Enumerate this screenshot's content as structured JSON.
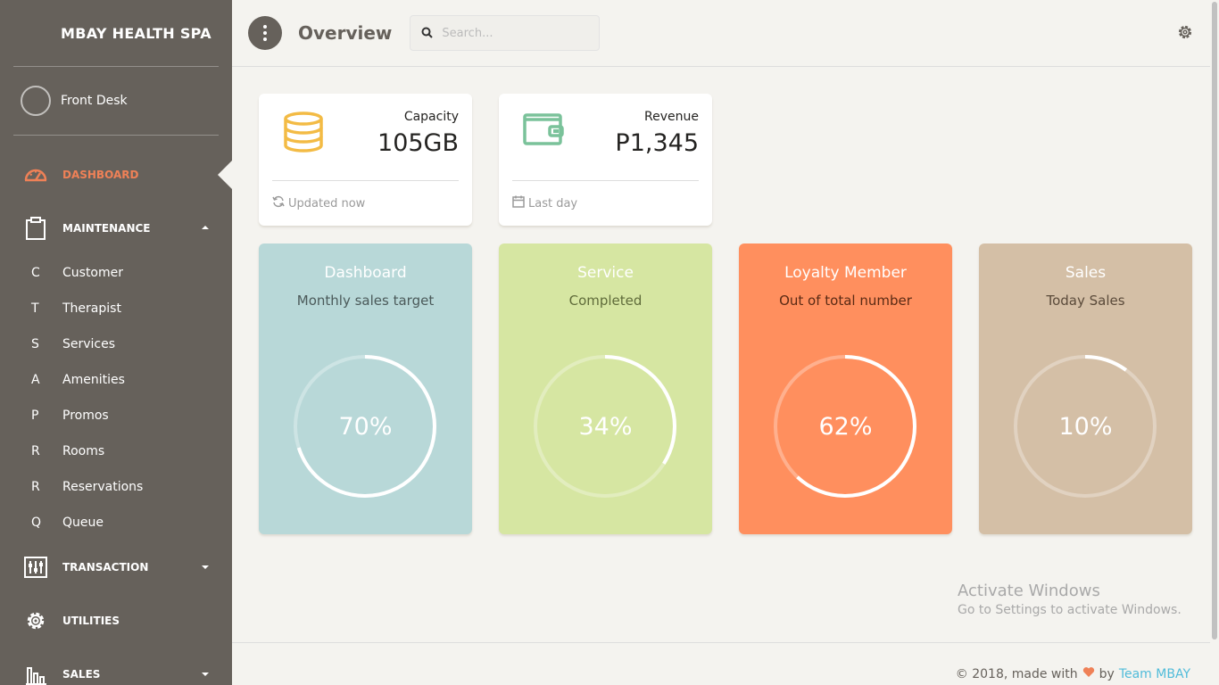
{
  "sidebar": {
    "brand": "MBAY HEALTH SPA",
    "user": "Front Desk",
    "nav": {
      "dashboard": "DASHBOARD",
      "maintenance": "MAINTENANCE",
      "transaction": "TRANSACTION",
      "utilities": "UTILITIES",
      "sales": "SALES"
    },
    "maintenance_items": [
      {
        "abbr": "C",
        "label": "Customer"
      },
      {
        "abbr": "T",
        "label": "Therapist"
      },
      {
        "abbr": "S",
        "label": "Services"
      },
      {
        "abbr": "A",
        "label": "Amenities"
      },
      {
        "abbr": "P",
        "label": "Promos"
      },
      {
        "abbr": "R",
        "label": "Rooms"
      },
      {
        "abbr": "R",
        "label": "Reservations"
      },
      {
        "abbr": "Q",
        "label": "Queue"
      }
    ]
  },
  "header": {
    "title": "Overview",
    "search_placeholder": "Search..."
  },
  "stats": [
    {
      "label": "Capacity",
      "value": "105GB",
      "footer": "Updated now",
      "icon": "database-icon",
      "color": "#f3bb45"
    },
    {
      "label": "Revenue",
      "value": "P1,345",
      "footer": "Last day",
      "icon": "wallet-icon",
      "color": "#7ac29a"
    }
  ],
  "gauges": [
    {
      "title": "Dashboard",
      "subtitle": "Monthly sales target",
      "value_text": "70%",
      "percent": 70,
      "bg": "#b8d8d8",
      "sub_color": "#4b5a5a"
    },
    {
      "title": "Service",
      "subtitle": "Completed",
      "value_text": "34%",
      "percent": 34,
      "bg": "#d6e6a2",
      "sub_color": "#5f6b3a"
    },
    {
      "title": "Loyalty Member",
      "subtitle": "Out of total number",
      "value_text": "62%",
      "percent": 62,
      "bg": "#ff8f5e",
      "sub_color": "#5a2a14"
    },
    {
      "title": "Sales",
      "subtitle": "Today Sales",
      "value_text": "10%",
      "percent": 10,
      "bg": "#d4bfa6",
      "sub_color": "#5a4a3a"
    }
  ],
  "watermark": {
    "line1": "Activate Windows",
    "line2": "Go to Settings to activate Windows."
  },
  "footer": {
    "copyright": "© 2018, made with",
    "by": "by",
    "team": "Team MBAY"
  }
}
